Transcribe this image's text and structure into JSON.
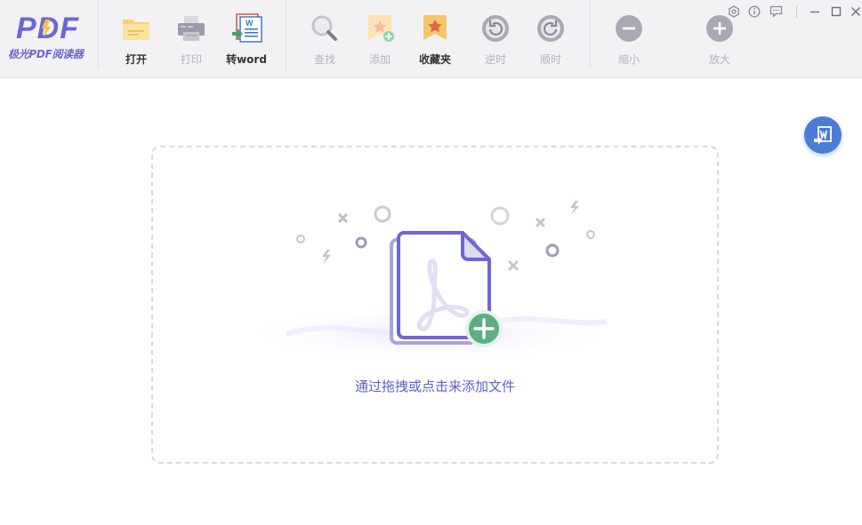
{
  "app": {
    "logo_text": "PDF",
    "subtitle": "极光PDF阅读器"
  },
  "toolbar": {
    "open": "打开",
    "print": "打印",
    "to_word": "转word",
    "find": "查找",
    "add": "添加",
    "favorites": "收藏夹",
    "rotate_ccw": "逆时",
    "rotate_cw": "顺时",
    "zoom_out": "缩小",
    "zoom_in": "放大"
  },
  "dropzone": {
    "hint": "通过拖拽或点击来添加文件"
  },
  "colors": {
    "accent": "#6d66d4",
    "hint_text": "#5c62c9",
    "badge_blue": "#4a7ed6",
    "plus_green": "#5dae80"
  },
  "icons": {
    "window": [
      "settings-icon",
      "info-icon",
      "feedback-icon",
      "minimize-icon",
      "maximize-icon",
      "close-icon"
    ],
    "side": "word-convert-icon"
  }
}
